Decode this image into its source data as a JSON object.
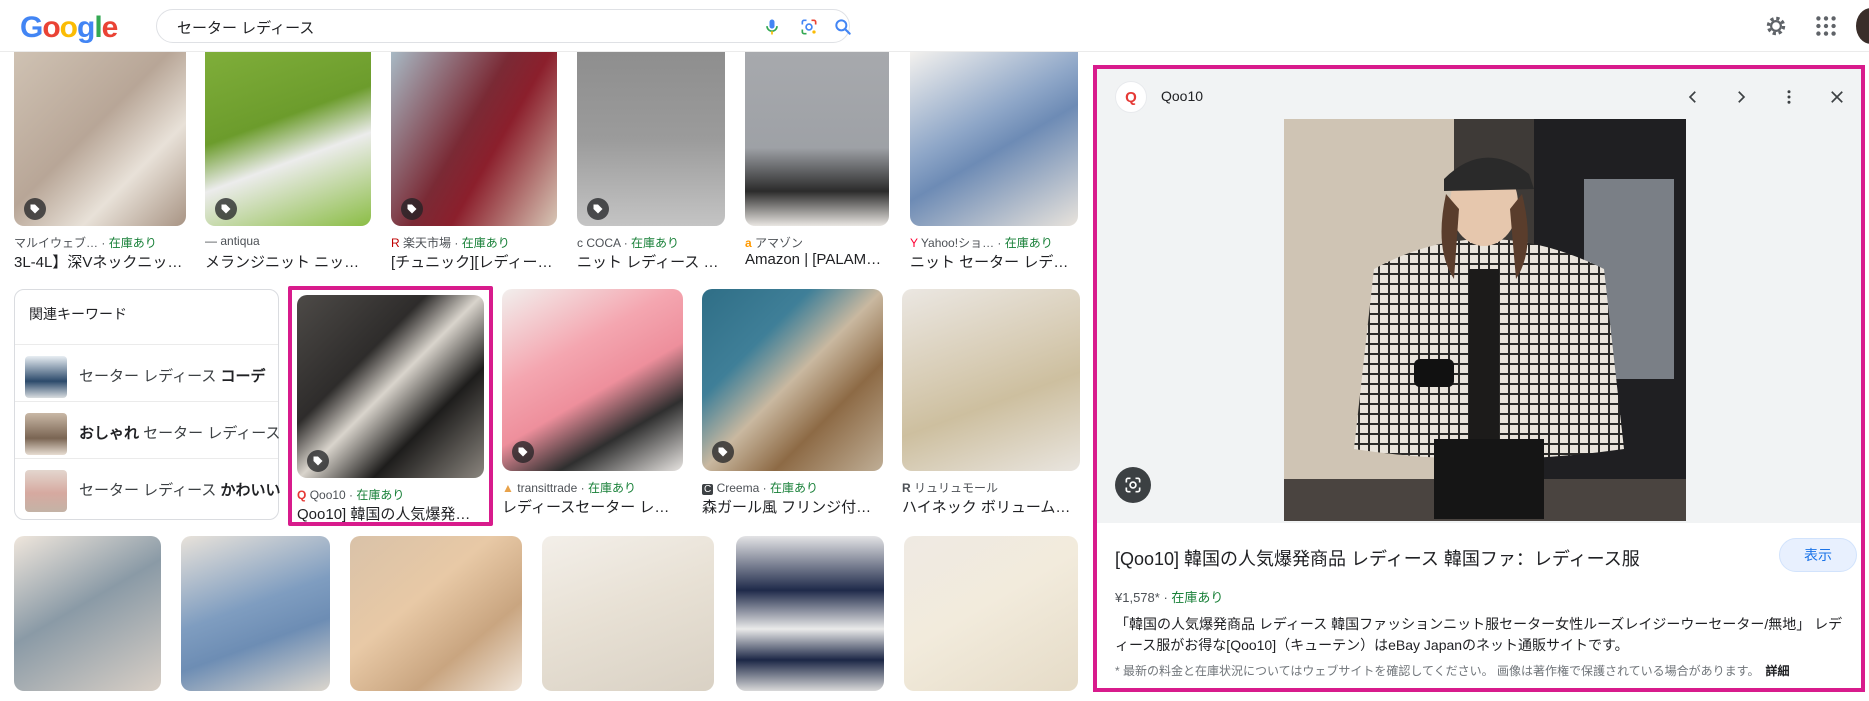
{
  "header": {
    "logo": [
      "G",
      "o",
      "o",
      "g",
      "l",
      "e"
    ],
    "logo_colors": [
      "#4285f4",
      "#ea4335",
      "#fbbc05",
      "#4285f4",
      "#34a853",
      "#ea4335"
    ],
    "search_query": "セーター レディース"
  },
  "row1": [
    {
      "source": "マルイウェブ…",
      "stock": "在庫あり",
      "title": "3L-4L】深Vネックニッ…"
    },
    {
      "source": "antiqua",
      "stock": "",
      "title": "メランジニット ニット …"
    },
    {
      "source": "楽天市場",
      "stock": "在庫あり",
      "title": "[チュニック][レディー…"
    },
    {
      "source": "COCA",
      "stock": "在庫あり",
      "title": "ニット レディース V…"
    },
    {
      "source": "アマゾン",
      "stock": "",
      "title": "Amazon | [PALAME…"
    },
    {
      "source": "Yahoo!ショ…",
      "stock": "在庫あり",
      "title": "ニット セーター レデ…"
    }
  ],
  "row2": [
    {
      "source": "Qoo10",
      "stock": "在庫あり",
      "title": "Qoo10] 韓国の人気爆発商…"
    },
    {
      "source": "transittrade",
      "stock": "在庫あり",
      "title": "レディースセーター レデ…"
    },
    {
      "source": "Creema",
      "stock": "在庫あり",
      "title": "森ガール風 フリンジ付き …"
    },
    {
      "source": "リュリュモール",
      "stock": "",
      "title": "ハイネック ボリューム二…"
    }
  ],
  "related": {
    "heading": "関連キーワード",
    "items": [
      {
        "plain": "セーター レディース ",
        "bold": "コーデ",
        "bold_first": false
      },
      {
        "plain": " セーター レディース",
        "bold": "おしゃれ",
        "bold_first": true
      },
      {
        "plain": "セーター レディース ",
        "bold": "かわいい",
        "bold_first": false
      }
    ]
  },
  "panel": {
    "favicon": "Q",
    "site": "Qoo10",
    "title": "[Qoo10] 韓国の人気爆発商品 レディース 韓国ファ：レディース服",
    "visit_label": "表示",
    "price": "¥1,578*",
    "stock": "在庫あり",
    "description": "「韓国の人気爆発商品 レディース 韓国ファッションニット服セーター女性ルーズレイジーウーセーター/無地」 レディース服がお得な[Qoo10]（キューテン）はeBay Japanのネット通販サイトです。",
    "note": "* 最新の料金と在庫状況についてはウェブサイトを確認してください。 画像は著作権で保護されている場合があります。",
    "note_more": "詳細"
  },
  "colors": {
    "accent_border": "#d81b8c",
    "stock_green": "#188038",
    "link_blue": "#1a73e8"
  }
}
